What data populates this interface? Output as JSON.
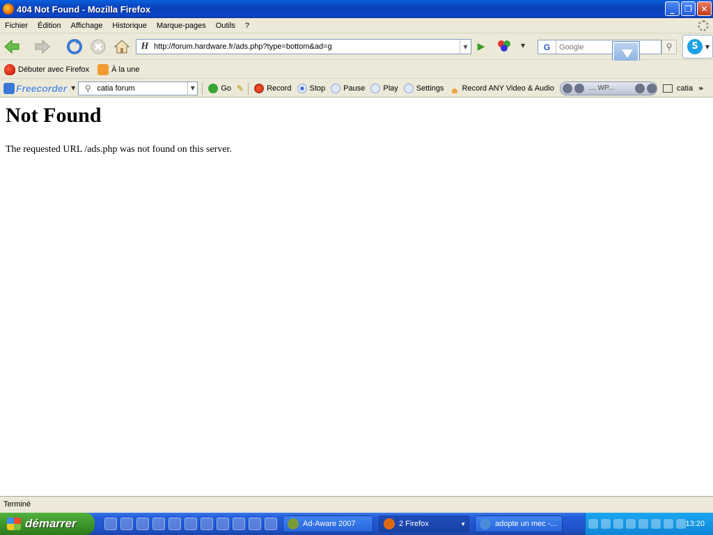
{
  "window": {
    "title": "404 Not Found - Mozilla Firefox",
    "minimize": "_",
    "maximize": "❐",
    "close": "✕"
  },
  "menu": {
    "items": [
      {
        "label": "Fichier"
      },
      {
        "label": "Édition"
      },
      {
        "label": "Affichage"
      },
      {
        "label": "Historique"
      },
      {
        "label": "Marque-pages"
      },
      {
        "label": "Outils"
      },
      {
        "label": "?"
      }
    ]
  },
  "navigation": {
    "url": "http://forum.hardware.fr/ads.php?type=bottom&ad=g",
    "search_placeholder": "Google",
    "search_engine": "G"
  },
  "bookmarks": {
    "items": [
      {
        "label": "Débuter avec Firefox",
        "icon": "firefox-icon"
      },
      {
        "label": "À la une",
        "icon": "rss-icon"
      }
    ]
  },
  "freecorder": {
    "logo": "Freecorder",
    "search_value": "catia forum",
    "go": "Go",
    "record": "Record",
    "stop": "Stop",
    "pause": "Pause",
    "play": "Play",
    "settings": "Settings",
    "record_any": "Record ANY Video & Audio",
    "player_text": "....   WP...",
    "tail": "catia",
    "chevron": "»"
  },
  "page": {
    "heading": "Not Found",
    "message": "The requested URL /ads.php was not found on this server."
  },
  "status": {
    "text": "Terminé"
  },
  "taskbar": {
    "start_label": "démarrer",
    "tasks": [
      {
        "label": "Ad-Aware 2007"
      },
      {
        "label": "2 Firefox"
      },
      {
        "label": "adopte un mec -..."
      }
    ],
    "clock": "13:20"
  },
  "colors": {
    "titlebar": "#0a3fb8",
    "chrome": "#ece9d8",
    "taskbar": "#245edb",
    "start": "#3a9127"
  }
}
